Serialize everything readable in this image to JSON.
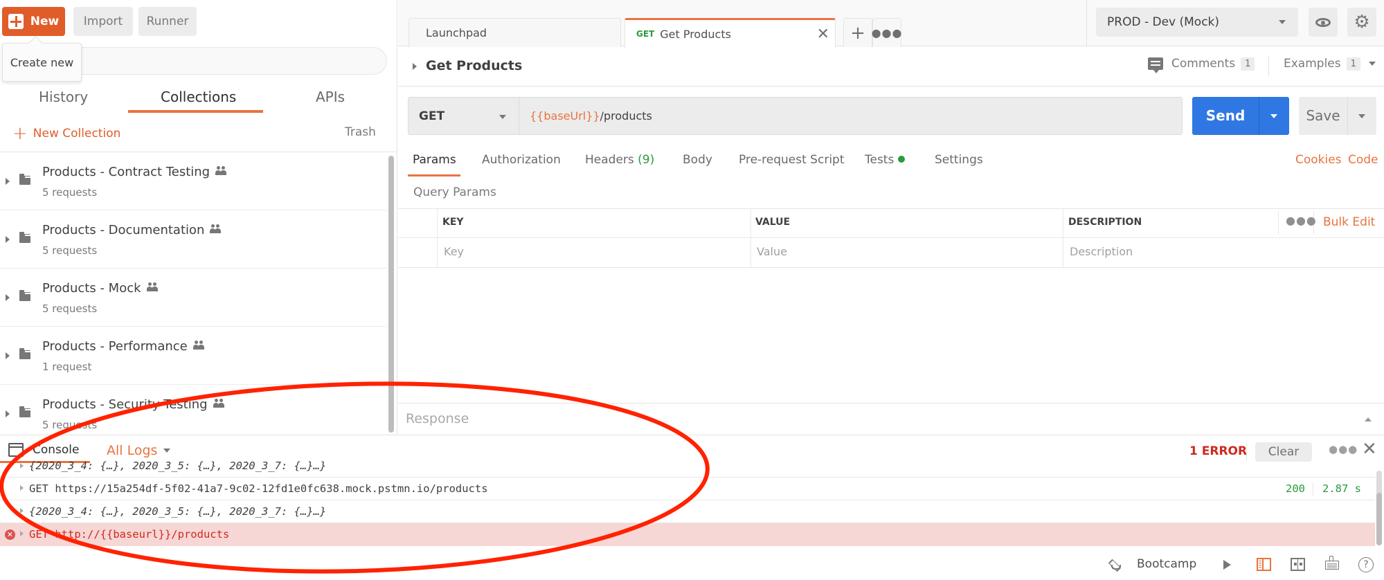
{
  "sidebar": {
    "buttons": {
      "new": "New",
      "import": "Import",
      "runner": "Runner"
    },
    "tooltip": "Create new",
    "tabs": [
      {
        "label": "History",
        "active": false
      },
      {
        "label": "Collections",
        "active": true
      },
      {
        "label": "APIs",
        "active": false
      }
    ],
    "new_collection": "New Collection",
    "trash": "Trash",
    "collections": [
      {
        "name": "Products - Contract Testing",
        "count": "5 requests",
        "shared": true
      },
      {
        "name": "Products - Documentation",
        "count": "5 requests",
        "shared": true
      },
      {
        "name": "Products - Mock",
        "count": "5 requests",
        "shared": true
      },
      {
        "name": "Products - Performance",
        "count": "1 request",
        "shared": true
      },
      {
        "name": "Products - Security Testing",
        "count": "5 requests",
        "shared": true
      }
    ]
  },
  "tabs": {
    "items": [
      {
        "label": "Launchpad",
        "method": "",
        "active": false
      },
      {
        "label": "Get Products",
        "method": "GET",
        "active": true
      }
    ],
    "add_icon": "plus-icon",
    "more_icon": "ellipsis-icon"
  },
  "environment": {
    "selected": "PROD - Dev (Mock)",
    "eye_icon": "eye-icon",
    "settings_icon": "gear-icon"
  },
  "request": {
    "title": "Get Products",
    "comments_label": "Comments",
    "comments_count": "1",
    "examples_label": "Examples",
    "examples_count": "1",
    "method": "GET",
    "url_variable": "{{baseUrl}}",
    "url_path": "/products",
    "send_label": "Send",
    "save_label": "Save",
    "sub_tabs": [
      {
        "label": "Params",
        "active": true
      },
      {
        "label": "Authorization"
      },
      {
        "label": "Headers",
        "count": "(9)"
      },
      {
        "label": "Body"
      },
      {
        "label": "Pre-request Script"
      },
      {
        "label": "Tests",
        "indicator": true
      },
      {
        "label": "Settings"
      }
    ],
    "cookies_label": "Cookies",
    "code_label": "Code",
    "query_params_label": "Query Params",
    "params_table": {
      "headers": [
        "KEY",
        "VALUE",
        "DESCRIPTION"
      ],
      "placeholders": {
        "key": "Key",
        "value": "Value",
        "description": "Description"
      },
      "bulk_edit": "Bulk Edit"
    },
    "response_label": "Response"
  },
  "console": {
    "tab_label": "Console",
    "filter": "All Logs",
    "error_count": "1 ERROR",
    "clear_label": "Clear",
    "logs": [
      {
        "type": "object",
        "text": "{2020_3_4: {…}, 2020_3_5: {…}, 2020_3_7: {…}…}"
      },
      {
        "type": "request",
        "text": "GET https://15a254df-5f02-41a7-9c02-12fd1e0fc638.mock.pstmn.io/products",
        "status": "200",
        "time": "2.87 s"
      },
      {
        "type": "object",
        "text": "{2020_3_4: {…}, 2020_3_5: {…}, 2020_3_7: {…}…}"
      },
      {
        "type": "error",
        "text": "GET http://{{baseurl}}/products"
      }
    ]
  },
  "statusbar": {
    "bootcamp": "Bootcamp"
  },
  "annotation": {
    "shape": "ellipse",
    "color": "#ff2200",
    "target": "console"
  },
  "colors": {
    "accent": "#e8733e",
    "new_button": "#e05d2a",
    "send_button": "#2f78e3",
    "success": "#2a9a3c",
    "error": "#d0281d",
    "error_row_bg": "#f6d7d5"
  }
}
